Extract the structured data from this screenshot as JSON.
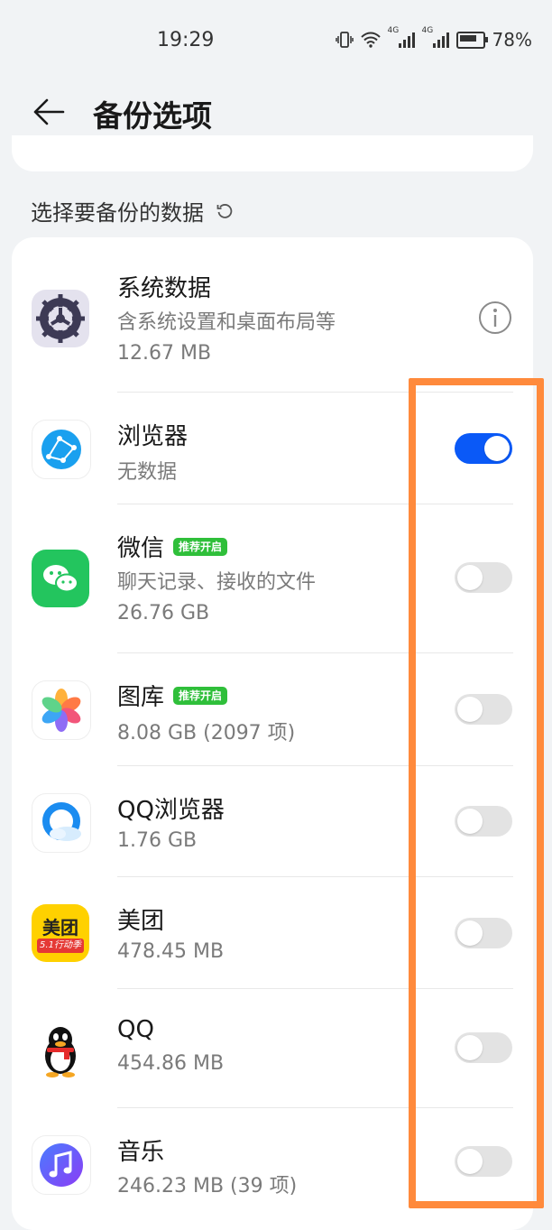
{
  "status_bar": {
    "time": "19:29",
    "battery": "78%",
    "network_1": "4G",
    "network_2": "4G"
  },
  "header": {
    "title": "备份选项"
  },
  "section": {
    "label": "选择要备份的数据"
  },
  "apps": [
    {
      "name": "系统数据",
      "desc": "含系统设置和桌面布局等",
      "size": "12.67 MB",
      "control": "info"
    },
    {
      "name": "浏览器",
      "desc": "无数据",
      "control": "toggle",
      "enabled": true
    },
    {
      "name": "微信",
      "badge": "推荐开启",
      "desc": "聊天记录、接收的文件",
      "size": "26.76 GB",
      "control": "toggle",
      "enabled": false
    },
    {
      "name": "图库",
      "badge": "推荐开启",
      "desc": "8.08 GB (2097 项)",
      "control": "toggle",
      "enabled": false
    },
    {
      "name": "QQ浏览器",
      "desc": "1.76 GB",
      "control": "toggle",
      "enabled": false
    },
    {
      "name": "美团",
      "desc": "478.45 MB",
      "icon_text_main": "美团",
      "icon_text_sub": "5.1行动季",
      "control": "toggle",
      "enabled": false
    },
    {
      "name": "QQ",
      "desc": "454.86 MB",
      "control": "toggle",
      "enabled": false
    },
    {
      "name": "音乐",
      "desc": "246.23 MB (39 项)",
      "control": "toggle",
      "enabled": false
    }
  ],
  "colors": {
    "accent": "#0a59f7",
    "highlight": "#ff8a3c",
    "badge": "#2fbf3a"
  }
}
